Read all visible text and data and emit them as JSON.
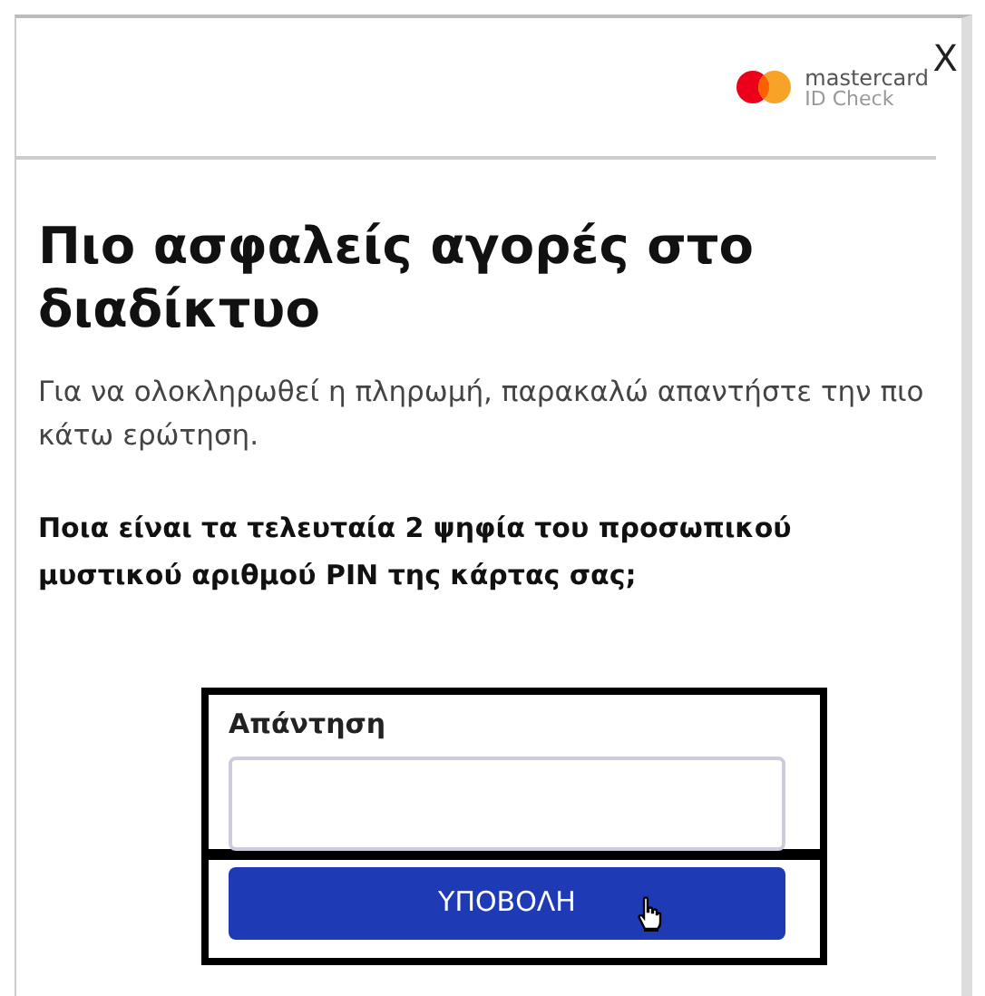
{
  "header": {
    "brand_line_1": "mastercard",
    "brand_line_2": "ID Check",
    "close": "X"
  },
  "title": "Πιο ασφαλείς αγορές στο διαδίκτυο",
  "intro": "Για να ολοκληρωθεί η πληρωμή, παρακαλώ απαντήστε την πιο κάτω ερώτηση.",
  "question": "Ποια είναι τα τελευταία 2 ψηφία του προσωπικού μυστικού αριθμού PIN της κάρτας σας;",
  "answer": {
    "label": "Απάντηση"
  },
  "submit_button": "ΥΠΟΒΟΛΗ"
}
